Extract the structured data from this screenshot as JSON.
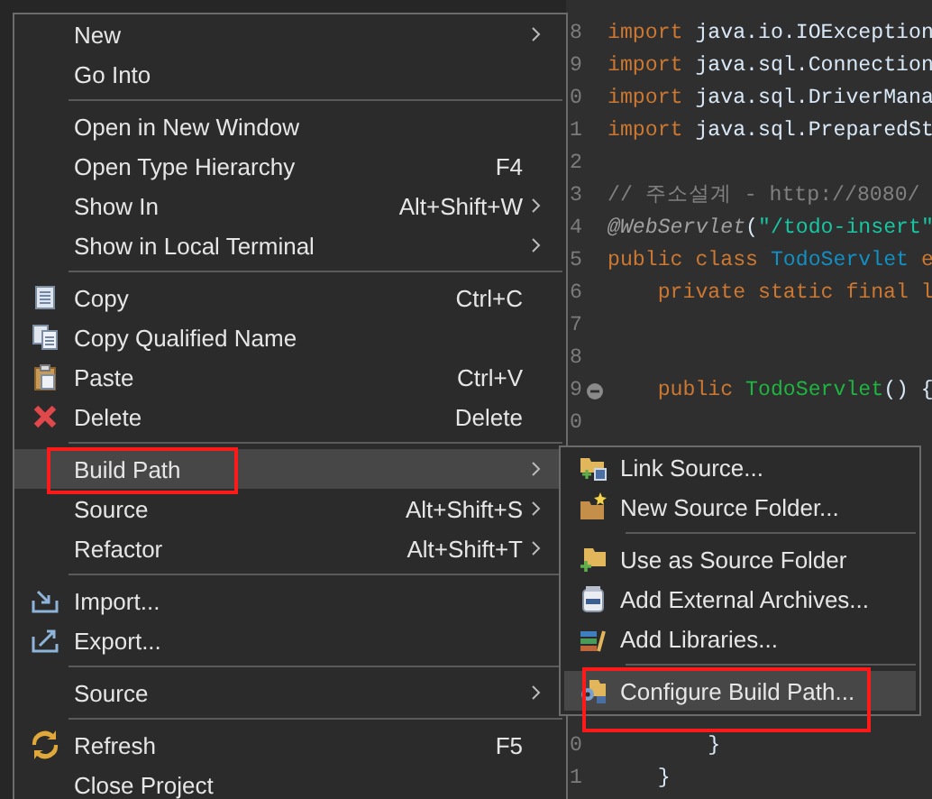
{
  "editor": {
    "lines_top": [
      {
        "number": "8",
        "tokens": [
          {
            "kind": "keyword",
            "text": "import"
          },
          {
            "kind": "plain",
            "text": " java.io.IOException"
          }
        ]
      },
      {
        "number": "9",
        "tokens": [
          {
            "kind": "keyword",
            "text": "import"
          },
          {
            "kind": "plain",
            "text": " java.sql.Connection"
          }
        ]
      },
      {
        "number": "0",
        "tokens": [
          {
            "kind": "keyword",
            "text": "import"
          },
          {
            "kind": "plain",
            "text": " java.sql.DriverMana"
          }
        ]
      },
      {
        "number": "1",
        "tokens": [
          {
            "kind": "keyword",
            "text": "import"
          },
          {
            "kind": "plain",
            "text": " java.sql.PreparedSt"
          }
        ]
      },
      {
        "number": "2"
      },
      {
        "number": "3",
        "tokens": [
          {
            "kind": "comment",
            "text": "// 주소설계 - http://8080/"
          }
        ]
      },
      {
        "number": "4",
        "tokens": [
          {
            "kind": "annotation",
            "text": "@WebServlet"
          },
          {
            "kind": "plain",
            "text": "("
          },
          {
            "kind": "string",
            "text": "\"/todo-insert\""
          }
        ]
      },
      {
        "number": "5",
        "tokens": [
          {
            "kind": "keyword",
            "text": "public class "
          },
          {
            "kind": "type",
            "text": "TodoServlet"
          },
          {
            "kind": "keyword",
            "text": " e"
          }
        ]
      },
      {
        "number": "6",
        "tokens": [
          {
            "kind": "keyword",
            "text": "    private static final l"
          }
        ]
      },
      {
        "number": "7"
      },
      {
        "number": "8"
      },
      {
        "number": "9",
        "fold": true,
        "tokens": [
          {
            "kind": "keyword",
            "text": "    public "
          },
          {
            "kind": "method",
            "text": "TodoServlet"
          },
          {
            "kind": "plain",
            "text": "() {"
          }
        ]
      },
      {
        "number": "0"
      }
    ],
    "lines_bottom": [
      {
        "number": "0",
        "tokens": [
          {
            "kind": "plain",
            "text": "        }"
          }
        ]
      },
      {
        "number": "1",
        "tokens": [
          {
            "kind": "plain",
            "text": "    }"
          }
        ]
      }
    ]
  },
  "context_menu": {
    "items": [
      {
        "kind": "item",
        "label": "New",
        "has_submenu": true,
        "selected": false
      },
      {
        "kind": "item",
        "label": "Go Into",
        "selected": false
      },
      {
        "kind": "separator"
      },
      {
        "kind": "item",
        "label": "Open in New Window",
        "selected": false
      },
      {
        "kind": "item",
        "label": "Open Type Hierarchy",
        "shortcut": "F4",
        "selected": false
      },
      {
        "kind": "item",
        "label": "Show In",
        "shortcut": "Alt+Shift+W",
        "has_submenu": true,
        "selected": false
      },
      {
        "kind": "item",
        "label": "Show in Local Terminal",
        "has_submenu": true,
        "selected": false
      },
      {
        "kind": "separator"
      },
      {
        "kind": "item",
        "label": "Copy",
        "shortcut": "Ctrl+C",
        "selected": false
      },
      {
        "kind": "item",
        "label": "Copy Qualified Name",
        "selected": false
      },
      {
        "kind": "item",
        "label": "Paste",
        "shortcut": "Ctrl+V",
        "selected": false
      },
      {
        "kind": "item",
        "label": "Delete",
        "shortcut": "Delete",
        "selected": false
      },
      {
        "kind": "separator"
      },
      {
        "kind": "item",
        "label": "Build Path",
        "has_submenu": true,
        "selected": true,
        "marked": true
      },
      {
        "kind": "item",
        "label": "Source",
        "shortcut": "Alt+Shift+S",
        "has_submenu": true,
        "selected": false
      },
      {
        "kind": "item",
        "label": "Refactor",
        "shortcut": "Alt+Shift+T",
        "has_submenu": true,
        "selected": false
      },
      {
        "kind": "separator"
      },
      {
        "kind": "item",
        "label": "Import...",
        "selected": false
      },
      {
        "kind": "item",
        "label": "Export...",
        "selected": false
      },
      {
        "kind": "separator"
      },
      {
        "kind": "item",
        "label": "Source",
        "has_submenu": true,
        "selected": false
      },
      {
        "kind": "separator"
      },
      {
        "kind": "item",
        "label": "Refresh",
        "shortcut": "F5",
        "selected": false
      },
      {
        "kind": "item",
        "label": "Close Project",
        "selected": false
      }
    ]
  },
  "submenu": {
    "items": [
      {
        "kind": "item",
        "label": "Link Source...",
        "selected": false
      },
      {
        "kind": "item",
        "label": "New Source Folder...",
        "selected": false
      },
      {
        "kind": "separator"
      },
      {
        "kind": "item",
        "label": "Use as Source Folder",
        "selected": false
      },
      {
        "kind": "item",
        "label": "Add External Archives...",
        "selected": false
      },
      {
        "kind": "item",
        "label": "Add Libraries...",
        "selected": false
      },
      {
        "kind": "separator"
      },
      {
        "kind": "item",
        "label": "Configure Build Path...",
        "selected": true,
        "marked": true
      }
    ]
  }
}
